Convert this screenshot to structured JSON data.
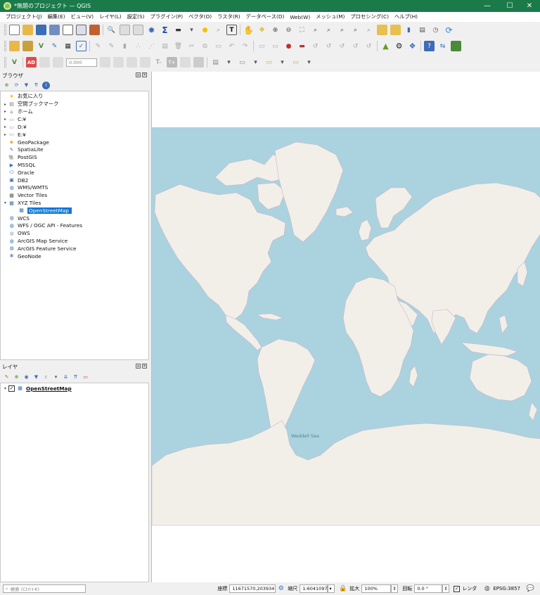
{
  "window": {
    "title": "*無題のプロジェクト — QGIS",
    "minimize": "—",
    "maximize": "☐",
    "close": "✕"
  },
  "menu": [
    "プロジェクト(J)",
    "編集(E)",
    "ビュー(V)",
    "レイヤ(L)",
    "設定(S)",
    "プラグイン(P)",
    "ベクタ(O)",
    "ラスタ(R)",
    "データベース(D)",
    "Web(W)",
    "メッシュ(M)",
    "プロセシング(C)",
    "ヘルプ(H)"
  ],
  "label_toolbar": {
    "font_size": "0.000",
    "ad_label": "AD",
    "t_minus": "T-",
    "t_plus": "T+"
  },
  "browser": {
    "title": "ブラウザ",
    "items": [
      {
        "label": "お気に入り",
        "icon": "star-icon",
        "color": "#f3c300",
        "glyph": "★",
        "arrow": "",
        "indent": 0
      },
      {
        "label": "空間ブックマーク",
        "icon": "bookmark-icon",
        "color": "#7a7a7a",
        "glyph": "▤",
        "arrow": "▸",
        "indent": 0
      },
      {
        "label": "ホーム",
        "icon": "home-folder-icon",
        "color": "#7a7a7a",
        "glyph": "⌂",
        "arrow": "▸",
        "indent": 0
      },
      {
        "label": "C:¥",
        "icon": "folder-icon",
        "color": "#9a9a9a",
        "glyph": "▭",
        "arrow": "▸",
        "indent": 0
      },
      {
        "label": "D:¥",
        "icon": "folder-icon",
        "color": "#9a9a9a",
        "glyph": "▭",
        "arrow": "▸",
        "indent": 0
      },
      {
        "label": "E:¥",
        "icon": "folder-icon",
        "color": "#9a9a9a",
        "glyph": "▭",
        "arrow": "▸",
        "indent": 0
      },
      {
        "label": "GeoPackage",
        "icon": "geopackage-icon",
        "color": "#e9b44c",
        "glyph": "◆",
        "arrow": "",
        "indent": 0
      },
      {
        "label": "SpatiaLite",
        "icon": "spatialite-icon",
        "color": "#4a7ab8",
        "glyph": "✎",
        "arrow": "",
        "indent": 0
      },
      {
        "label": "PostGIS",
        "icon": "postgis-icon",
        "color": "#336791",
        "glyph": "🐘",
        "arrow": "",
        "indent": 0
      },
      {
        "label": "MSSQL",
        "icon": "mssql-icon",
        "color": "#3a6fb0",
        "glyph": "▶",
        "arrow": "",
        "indent": 0
      },
      {
        "label": "Oracle",
        "icon": "oracle-icon",
        "color": "#3a6fb0",
        "glyph": "⬭",
        "arrow": "",
        "indent": 0
      },
      {
        "label": "DB2",
        "icon": "db2-icon",
        "color": "#3a6fb0",
        "glyph": "▣",
        "arrow": "",
        "indent": 0
      },
      {
        "label": "WMS/WMTS",
        "icon": "wms-globe-icon",
        "color": "#3a6fb0",
        "glyph": "◍",
        "arrow": "",
        "indent": 0
      },
      {
        "label": "Vector Tiles",
        "icon": "vector-tiles-icon",
        "color": "#5a5a5a",
        "glyph": "▦",
        "arrow": "",
        "indent": 0
      },
      {
        "label": "XYZ Tiles",
        "icon": "xyz-tiles-icon",
        "color": "#3a6fb0",
        "glyph": "▦",
        "arrow": "▾",
        "indent": 0
      },
      {
        "label": "OpenStreetMap",
        "icon": "xyz-layer-icon",
        "color": "#3a6fb0",
        "glyph": "▦",
        "arrow": "",
        "indent": 1,
        "selected": true
      },
      {
        "label": "WCS",
        "icon": "wcs-globe-icon",
        "color": "#3a6fb0",
        "glyph": "◍",
        "arrow": "",
        "indent": 0
      },
      {
        "label": "WFS / OGC API - Features",
        "icon": "wfs-globe-icon",
        "color": "#3a6fb0",
        "glyph": "◍",
        "arrow": "",
        "indent": 0
      },
      {
        "label": "OWS",
        "icon": "ows-globe-icon",
        "color": "#8aa0c0",
        "glyph": "◍",
        "arrow": "",
        "indent": 0
      },
      {
        "label": "ArcGIS Map Service",
        "icon": "arcgis-map-icon",
        "color": "#3a6fb0",
        "glyph": "◍",
        "arrow": "",
        "indent": 0
      },
      {
        "label": "ArcGIS Feature Service",
        "icon": "arcgis-feature-icon",
        "color": "#3a6fb0",
        "glyph": "◍",
        "arrow": "",
        "indent": 0
      },
      {
        "label": "GeoNode",
        "icon": "geonode-icon",
        "color": "#3a6fb0",
        "glyph": "✻",
        "arrow": "",
        "indent": 0
      }
    ]
  },
  "layers": {
    "title": "レイヤ",
    "items": [
      {
        "label": "OpenStreetMap",
        "checked": true
      }
    ]
  },
  "map": {
    "ocean_label": "Weddell Sea",
    "ocean_color": "#aad3df",
    "land_color": "#f2efe9",
    "border_color": "#c9b4c8"
  },
  "status": {
    "search_placeholder": "検索 (Ctrl+K)",
    "coord_label": "座標",
    "coord_value": "11671570,20393415",
    "scale_label": "縮尺",
    "scale_value": "1:60410976",
    "magnifier_label": "拡大",
    "magnifier_value": "100%",
    "rotation_label": "回転",
    "rotation_value": "0.0 °",
    "render_label": "レンダ",
    "crs": "EPSG:3857"
  }
}
